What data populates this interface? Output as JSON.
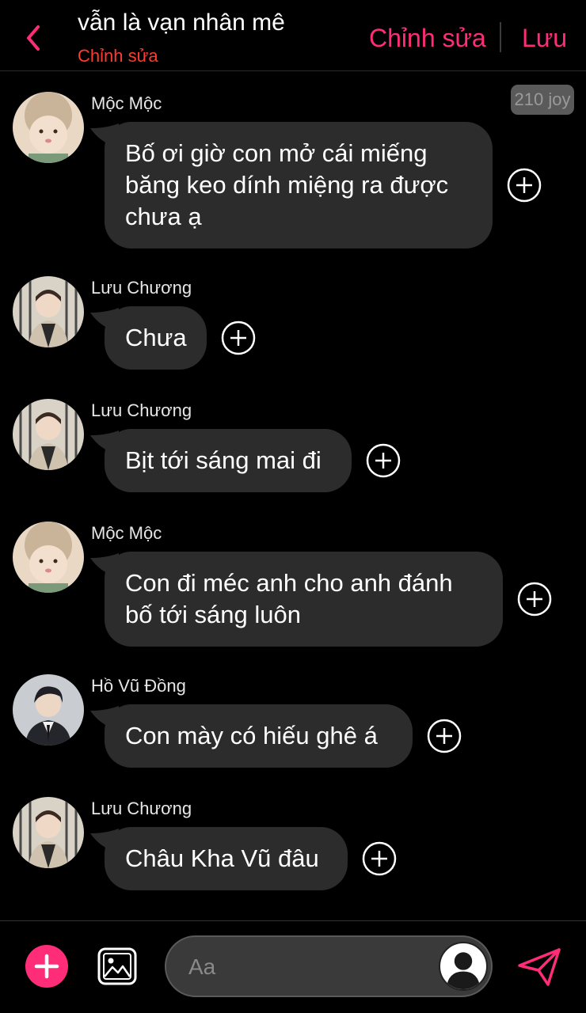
{
  "header": {
    "title": "vẫn là vạn nhân mê",
    "subtitle": "Chỉnh sửa",
    "edit_label": "Chỉnh sửa",
    "save_label": "Lưu",
    "back_icon": "chevron-left-icon"
  },
  "joy_badge": "210 joy",
  "messages": [
    {
      "sender": "Mộc Mộc",
      "avatar": "baby-avatar",
      "text": "Bố ơi giờ con mở cái miếng băng keo dính miệng ra được chưa ạ"
    },
    {
      "sender": "Lưu Chương",
      "avatar": "boy-avatar",
      "text": "Chưa"
    },
    {
      "sender": "Lưu Chương",
      "avatar": "boy-avatar",
      "text": "Bịt tới sáng mai đi"
    },
    {
      "sender": "Mộc Mộc",
      "avatar": "baby-avatar",
      "text": "Con đi méc anh cho anh đánh bố tới sáng luôn"
    },
    {
      "sender": "Hồ Vũ Đồng",
      "avatar": "man-avatar",
      "text": "Con mày có hiếu ghê á"
    },
    {
      "sender": "Lưu Chương",
      "avatar": "boy-avatar",
      "text": "Châu Kha Vũ đâu"
    }
  ],
  "composer": {
    "placeholder": "Aa",
    "add_icon": "plus-icon",
    "image_icon": "image-icon",
    "send_icon": "send-icon",
    "avatar_icon": "user-silhouette-icon"
  },
  "colors": {
    "accent": "#ff2d78",
    "subtitle": "#ff3b30",
    "bubble": "#2c2c2c",
    "background": "#000000"
  }
}
